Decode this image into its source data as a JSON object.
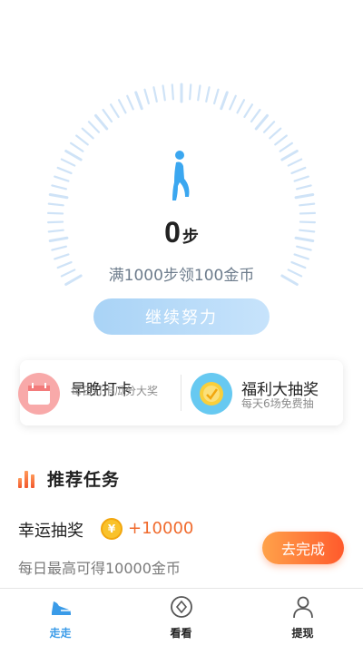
{
  "pedometer": {
    "steps": "0",
    "steps_unit": "步",
    "goal_text": "满1000步领100金币",
    "cta_label": "继续努力"
  },
  "cards": [
    {
      "title": "早晚打卡",
      "subtitle": "每日打卡瓜分大奖",
      "icon": "calendar-icon"
    },
    {
      "title": "福利大抽奖",
      "subtitle": "每天6场免费抽",
      "icon": "gift-coin-icon"
    }
  ],
  "section": {
    "title": "推荐任务",
    "icon": "bar-chart-icon"
  },
  "task": {
    "name": "幸运抽奖",
    "coin_symbol": "¥",
    "reward": "+10000",
    "description": "每日最高可得10000金币",
    "action_label": "去完成"
  },
  "tabbar": {
    "items": [
      {
        "label": "走走",
        "icon": "shoe-icon",
        "active": true
      },
      {
        "label": "看看",
        "icon": "compass-icon",
        "active": false
      },
      {
        "label": "提现",
        "icon": "user-icon",
        "active": false
      }
    ]
  },
  "colors": {
    "accent": "#3a9be8",
    "dial": "#cfe3f7",
    "cta": "#b8dbf8",
    "reward": "#f06a2c",
    "action": "#ff7a36"
  }
}
